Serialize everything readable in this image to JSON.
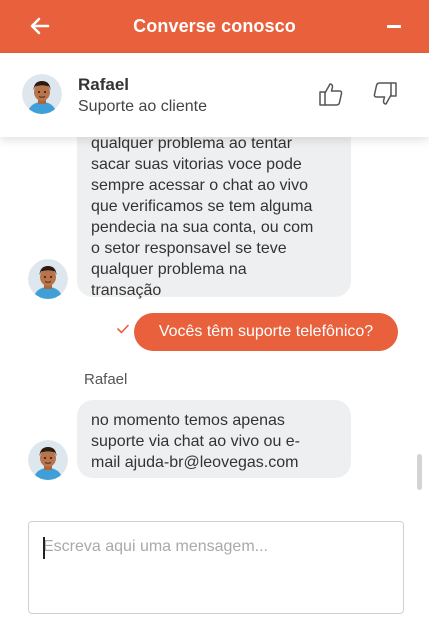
{
  "header": {
    "title": "Converse conosco",
    "back_icon": "arrow-left-icon",
    "minimize_icon": "minus-icon",
    "color": "#e8603c"
  },
  "agent": {
    "name": "Rafael",
    "role": "Suporte ao cliente",
    "thumbs_up_icon": "thumbs-up-icon",
    "thumbs_down_icon": "thumbs-down-icon"
  },
  "messages": [
    {
      "from": "agent",
      "lines": [
        "qualquer problema ao tentar",
        "sacar suas vitorias voce pode",
        "sempre acessar o chat ao vivo",
        "que verificamos se tem alguma",
        "pendecia na sua conta, ou com",
        "o setor responsavel se teve",
        "qualquer problema na",
        "transação"
      ]
    },
    {
      "from": "user",
      "text": "Vocês têm suporte telefônico?",
      "status_icon": "check-icon"
    },
    {
      "from": "agent",
      "sender": "Rafael",
      "lines": [
        "no momento temos apenas",
        "suporte via chat ao vivo ou e-",
        "mail ajuda-br@leovegas.com"
      ]
    }
  ],
  "composer": {
    "placeholder": "Escreva aqui uma mensagem...",
    "value": ""
  }
}
